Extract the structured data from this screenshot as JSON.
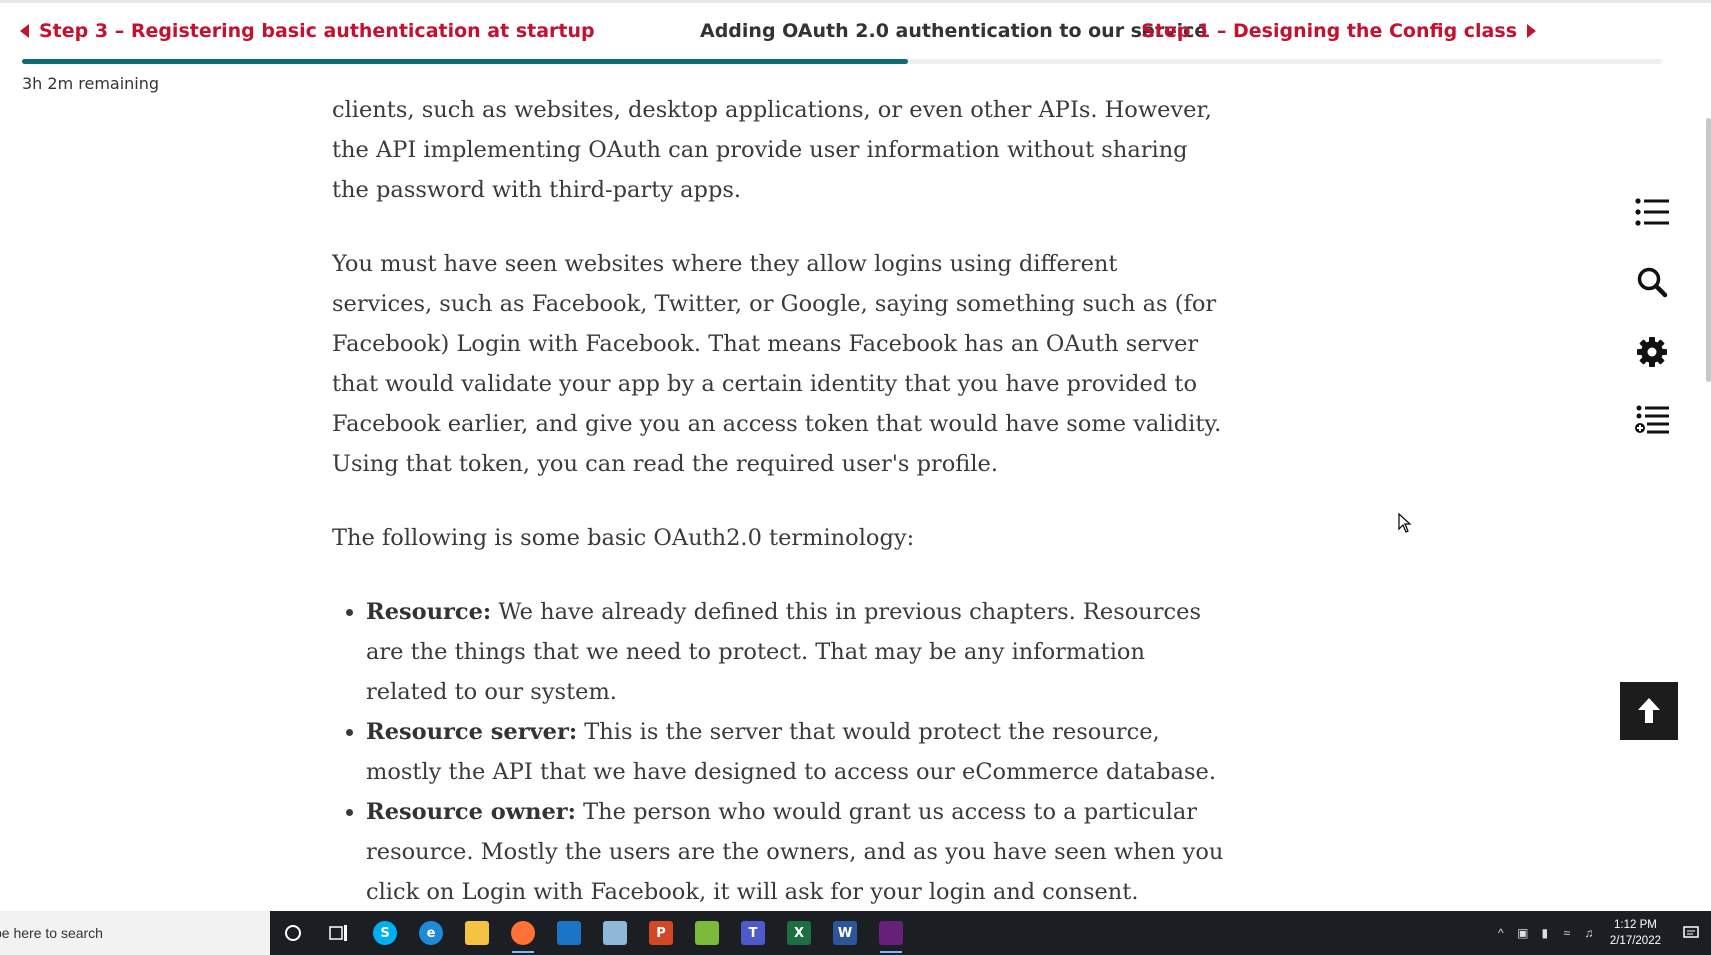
{
  "header": {
    "prev_label": "Step 3 – Registering basic authentication at startup",
    "title": "Adding OAuth 2.0 authentication to our service",
    "next_label": "Step 1 – Designing the Config class",
    "progress": 0.54,
    "time_remaining": "3h 2m remaining"
  },
  "content": {
    "paragraphs": [
      "clients, such as websites, desktop applications, or even other APIs. However, the API implementing OAuth can provide user information without sharing the pass­word with third-party apps.",
      "You must have seen websites where they allow logins using different services, such as Facebook, Twitter, or Google, saying something such as (for Facebook) Login with Facebook. That means Facebook has an OAuth server that would vali­date your app by a certain identity that you have provided to Facebook earlier, and give you an access token that would have some validity. Using that token, you can read the required user's profile.",
      "The following is some basic OAuth2.0 terminology:"
    ],
    "terms": [
      {
        "term": "Resource:",
        "text": " We have already defined this in previous chapters. Resources are the things that we need to protect. That may be any information related to our system."
      },
      {
        "term": "Resource server:",
        "text": " This is the server that would protect the resource, mostly the API that we have designed to access our eCommerce database."
      },
      {
        "term": "Resource owner:",
        "text": " The person who would grant us access to a particular re­source. Mostly the users are the owners, and as you have seen when you click on Login with Facebook, it will ask for your login and consent."
      }
    ]
  },
  "side_toolbar": {
    "icons": [
      "table-of-contents-icon",
      "search-icon",
      "settings-gear-icon",
      "add-to-playlist-icon"
    ],
    "back_to_top_icon": "arrow-up-icon"
  },
  "taskbar": {
    "search_text": "pe here to search",
    "apps": [
      "cortana-icon",
      "task-view-icon",
      "skype-icon",
      "edge-icon",
      "file-explorer-icon",
      "firefox-icon",
      "photos-icon",
      "notepad-icon",
      "powerpoint-icon",
      "notepad-plus-icon",
      "teams-icon",
      "excel-icon",
      "word-icon",
      "visual-studio-icon"
    ],
    "time": "1:12 PM",
    "date": "2/17/2022"
  },
  "colors": {
    "accent_red": "#c4112f",
    "progress_teal": "#0f6b72",
    "taskbar_bg": "#1b1f24"
  }
}
